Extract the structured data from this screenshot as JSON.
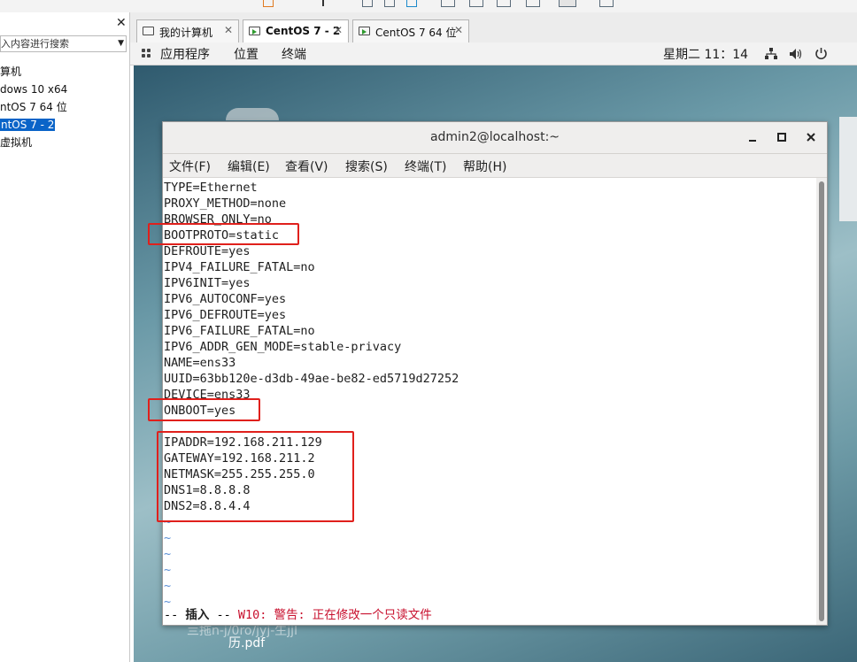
{
  "left_panel": {
    "close_glyph": "✕",
    "search_placeholder": "入内容进行搜索",
    "dropdown_glyph": "▼",
    "items": [
      {
        "label": "算机"
      },
      {
        "label": "dows 10 x64"
      },
      {
        "label": "ntOS 7 64 位"
      },
      {
        "label": "ntOS 7 - 2"
      },
      {
        "label": "虚拟机"
      }
    ]
  },
  "tabs": [
    {
      "label": "我的计算机",
      "icon": "computer-icon"
    },
    {
      "label": "CentOS 7 - 2",
      "icon": "vm-running-icon"
    },
    {
      "label": "CentOS 7 64 位",
      "icon": "vm-running-icon"
    }
  ],
  "tab_close_glyph": "✕",
  "gnome_bar": {
    "applications": "应用程序",
    "places": "位置",
    "terminal": "终端",
    "clock": "星期二 11：14"
  },
  "desktop": {
    "file_label": "历.pdf",
    "file_label_partial": "亖拖n-j/0ro/jyj-生jjl"
  },
  "terminal": {
    "title": "admin2@localhost:~",
    "menu": [
      "文件(F)",
      "编辑(E)",
      "查看(V)",
      "搜索(S)",
      "终端(T)",
      "帮助(H)"
    ],
    "lines": [
      "TYPE=Ethernet",
      "PROXY_METHOD=none",
      "BROWSER_ONLY=no",
      "BOOTPROTO=static",
      "DEFROUTE=yes",
      "IPV4_FAILURE_FATAL=no",
      "IPV6INIT=yes",
      "IPV6_AUTOCONF=yes",
      "IPV6_DEFROUTE=yes",
      "IPV6_FAILURE_FATAL=no",
      "IPV6_ADDR_GEN_MODE=stable-privacy",
      "NAME=ens33",
      "UUID=63bb120e-d3db-49ae-be82-ed5719d27252",
      "DEVICE=ens33",
      "ONBOOT=yes",
      "",
      "IPADDR=192.168.211.129",
      "GATEWAY=192.168.211.2",
      "NETMASK=255.255.255.0",
      "DNS1=8.8.8.8",
      "DNS2=8.8.4.4",
      "~",
      "~",
      "~",
      "~",
      "~",
      "~"
    ],
    "status_prefix": "-- ",
    "status_mode": "插入",
    "status_mid": " -- ",
    "status_warning": "W10: 警告: 正在修改一个只读文件"
  },
  "colors": {
    "highlight": "#e0201c",
    "selection": "#0a64c8",
    "tilde": "#5a8fd6",
    "warning": "#c8102e"
  }
}
